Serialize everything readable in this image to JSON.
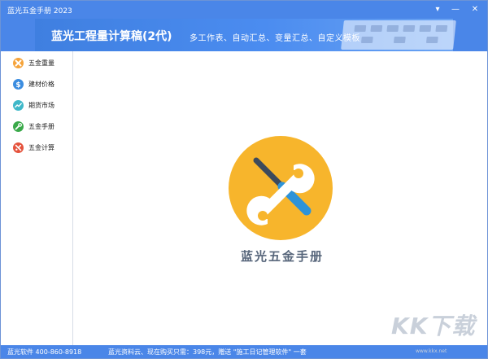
{
  "window": {
    "title": "蓝光五金手册 2023",
    "controls": {
      "menu": "▾",
      "minimize": "—",
      "close": "✕"
    }
  },
  "banner": {
    "title": "蓝光工程量计算稿(2代)",
    "subtitle": "多工作表、自动汇总、变量汇总、自定义模板"
  },
  "sidebar": {
    "items": [
      {
        "label": "五金重量",
        "icon": "cross-weight-icon",
        "color": "#f5a33a"
      },
      {
        "label": "建材价格",
        "icon": "dollar-icon",
        "color": "#3b8de0"
      },
      {
        "label": "期货市场",
        "icon": "trend-icon",
        "color": "#3fb8c9"
      },
      {
        "label": "五金手册",
        "icon": "wrench-icon",
        "color": "#3aa94a"
      },
      {
        "label": "五金计算",
        "icon": "tools-icon",
        "color": "#e5533d"
      }
    ]
  },
  "main": {
    "logo_icon": "wrench-screwdriver-icon",
    "logo_color": "#f7b52c",
    "logo_text": "蓝光五金手册"
  },
  "statusbar": {
    "contact": "蓝光软件 400-860-8918",
    "promo": "蓝光资料云、现在购买只需：398元，赠送 \"施工日记管理软件\" 一套"
  },
  "watermark": {
    "text": "KK下载",
    "url": "www.kkx.net"
  }
}
